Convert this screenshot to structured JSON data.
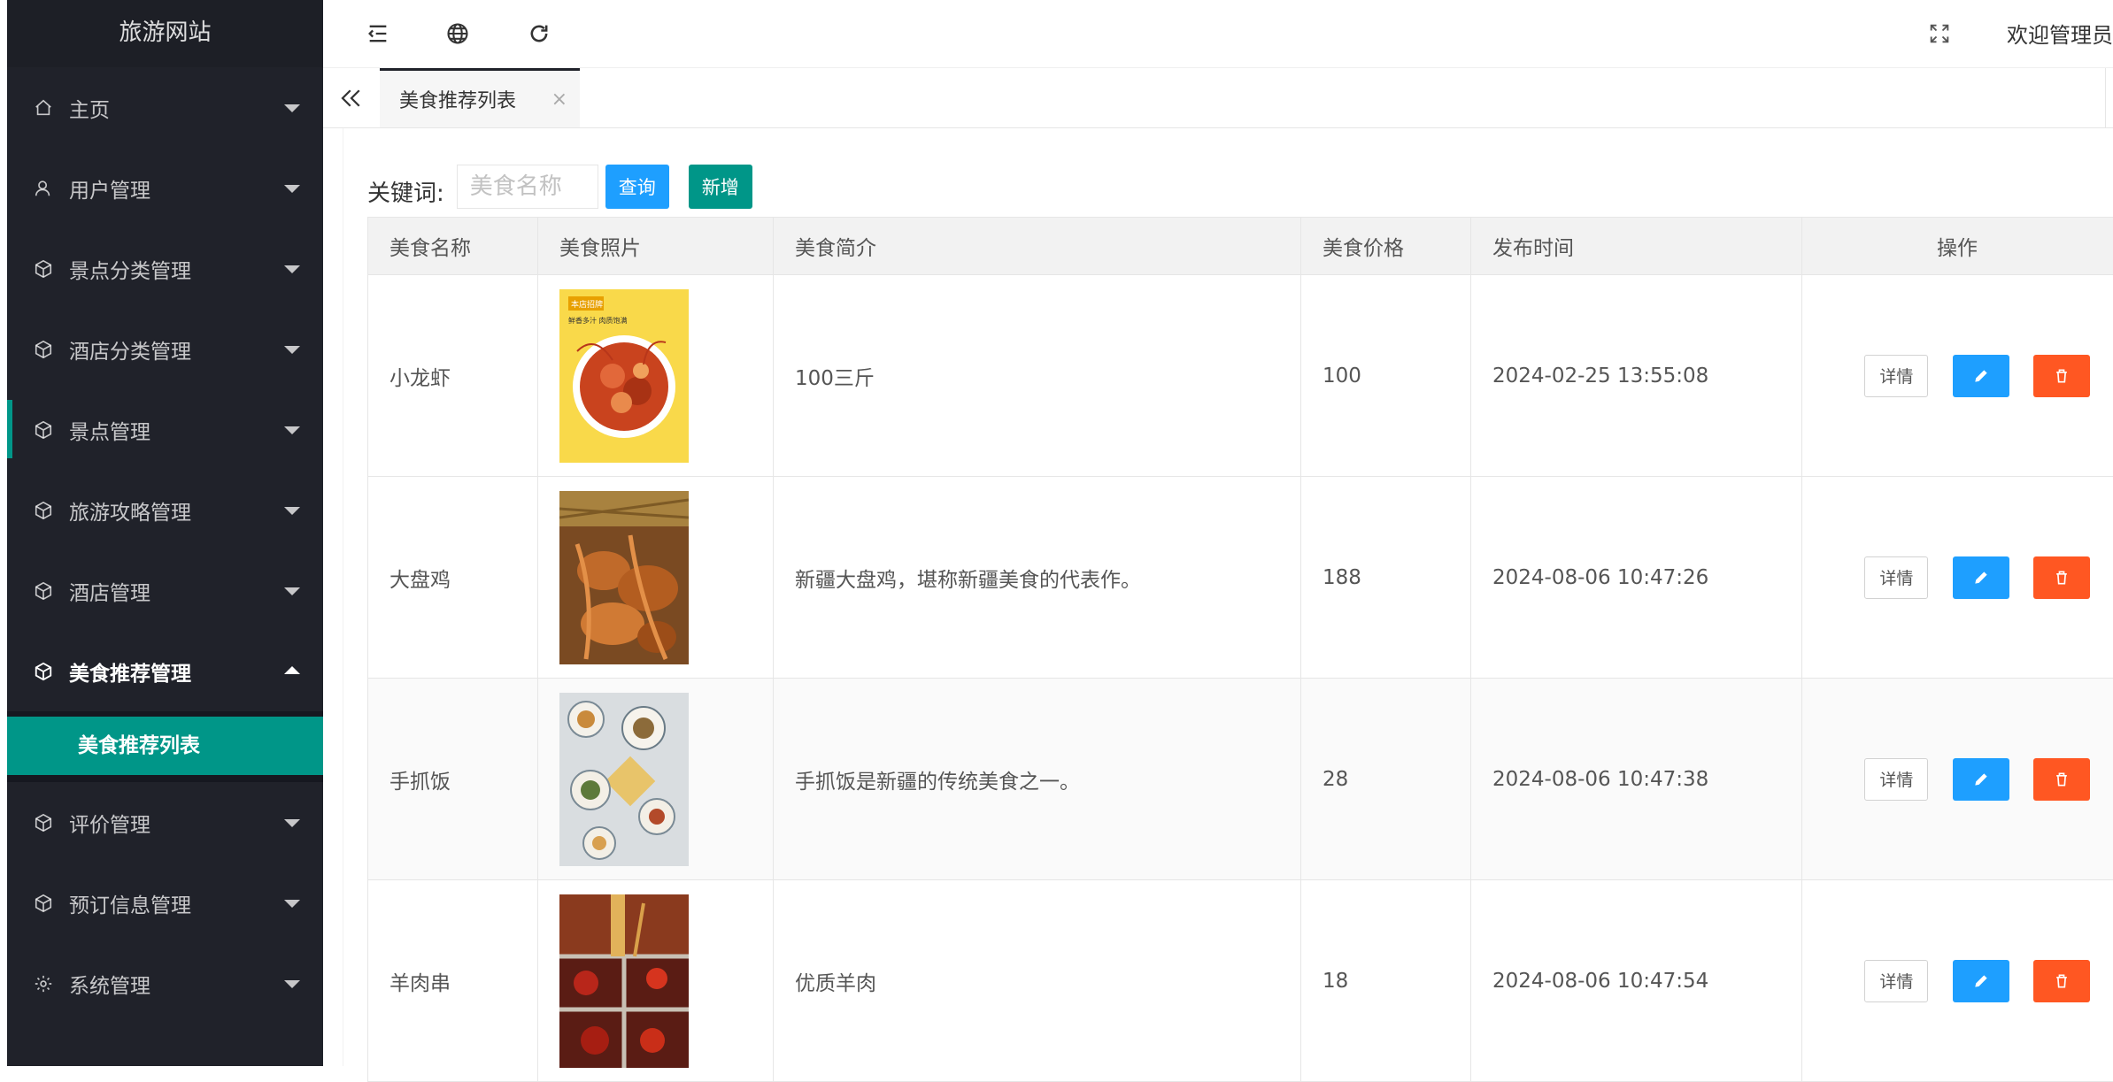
{
  "app": {
    "title": "旅游网站"
  },
  "colors": {
    "sidebar_bg": "#20222a",
    "accent_teal": "#009688",
    "blue": "#1e9fff",
    "orange": "#ff5722"
  },
  "sidebar": {
    "items": [
      {
        "label": "主页",
        "icon": "home-icon"
      },
      {
        "label": "用户管理",
        "icon": "user-icon"
      },
      {
        "label": "景点分类管理",
        "icon": "cube-icon"
      },
      {
        "label": "酒店分类管理",
        "icon": "cube-icon"
      },
      {
        "label": "景点管理",
        "icon": "cube-icon"
      },
      {
        "label": "旅游攻略管理",
        "icon": "cube-icon"
      },
      {
        "label": "酒店管理",
        "icon": "cube-icon"
      },
      {
        "label": "美食推荐管理",
        "icon": "cube-icon",
        "expanded": true,
        "children": [
          {
            "label": "美食推荐列表",
            "active": true
          }
        ]
      },
      {
        "label": "评价管理",
        "icon": "cube-icon"
      },
      {
        "label": "预订信息管理",
        "icon": "cube-icon"
      },
      {
        "label": "系统管理",
        "icon": "gear-icon"
      }
    ]
  },
  "header": {
    "welcome": "欢迎管理员"
  },
  "tabs": {
    "active_label": "美食推荐列表",
    "close_glyph": "×"
  },
  "search": {
    "label": "关键词:",
    "placeholder": "美食名称",
    "value": "",
    "query_label": "查询",
    "add_label": "新增"
  },
  "table": {
    "columns": [
      "美食名称",
      "美食照片",
      "美食简介",
      "美食价格",
      "发布时间",
      "操作"
    ],
    "detail_label": "详情",
    "rows": [
      {
        "name": "小龙虾",
        "photo": "crayfish-photo",
        "intro": "100三斤",
        "price": "100",
        "time": "2024-02-25 13:55:08",
        "poster_text_1": "本店招牌",
        "poster_text_2": "鲜香多汁 肉质饱满"
      },
      {
        "name": "大盘鸡",
        "photo": "dapanji-photo",
        "intro": "新疆大盘鸡，堪称新疆美食的代表作。",
        "price": "188",
        "time": "2024-08-06 10:47:26"
      },
      {
        "name": "手抓饭",
        "photo": "pilaf-photo",
        "intro": "手抓饭是新疆的传统美食之一。",
        "price": "28",
        "time": "2024-08-06 10:47:38"
      },
      {
        "name": "羊肉串",
        "photo": "lamb-skewer-photo",
        "intro": "优质羊肉",
        "price": "18",
        "time": "2024-08-06 10:47:54"
      }
    ]
  }
}
